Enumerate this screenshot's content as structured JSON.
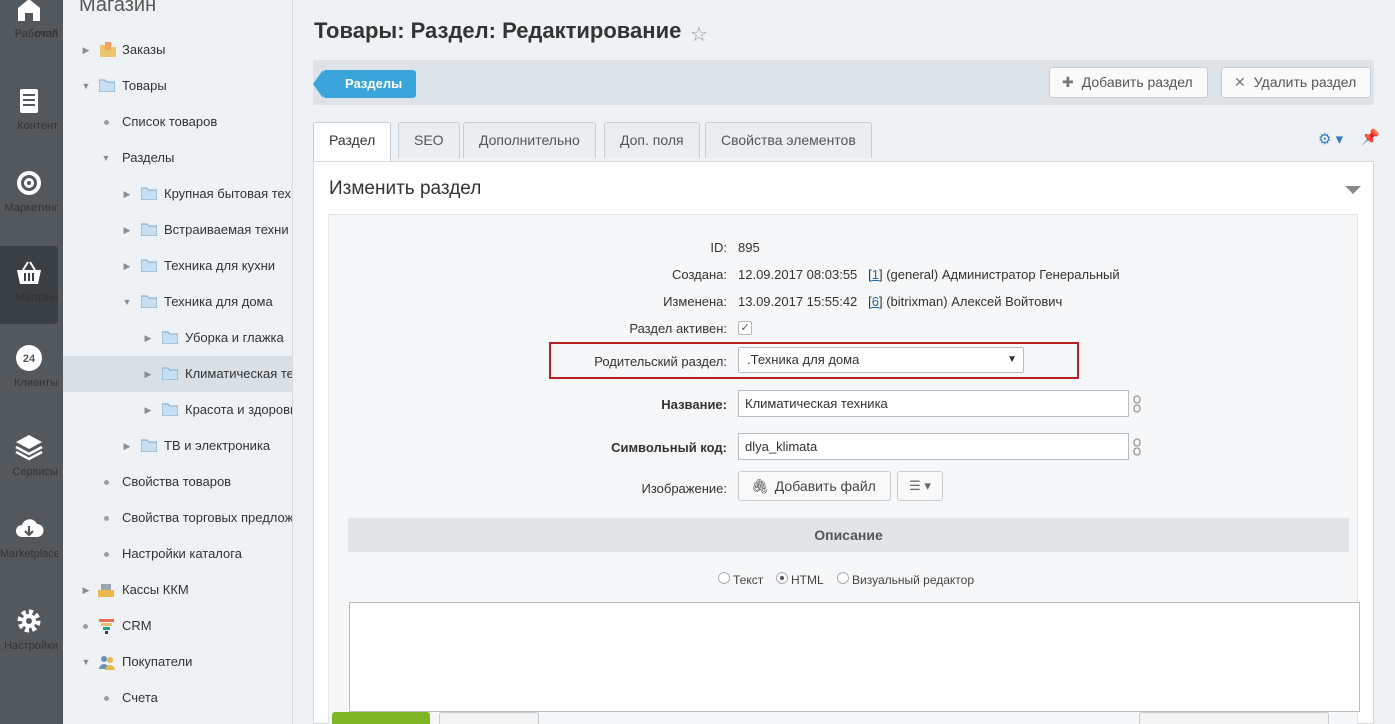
{
  "rail": {
    "items": [
      {
        "label_line1": "Рабочий",
        "label_line2": "стол",
        "icon": "home-icon"
      },
      {
        "label_line1": "Контент",
        "label_line2": "",
        "icon": "document-icon"
      },
      {
        "label_line1": "Маркетинг",
        "label_line2": "",
        "icon": "target-icon"
      },
      {
        "label_line1": "Магазин",
        "label_line2": "",
        "icon": "basket-icon"
      },
      {
        "label_line1": "Клиенты",
        "label_line2": "",
        "icon": "clients-24-icon",
        "badge": "24"
      },
      {
        "label_line1": "Сервисы",
        "label_line2": "",
        "icon": "layers-icon"
      },
      {
        "label_line1": "Marketplace",
        "label_line2": "",
        "icon": "cloud-download-icon"
      },
      {
        "label_line1": "Настройки",
        "label_line2": "",
        "icon": "gear-icon"
      }
    ]
  },
  "tree": {
    "title": "Магазин",
    "items": [
      {
        "label": "Заказы"
      },
      {
        "label": "Товары"
      },
      {
        "label": "Список товаров"
      },
      {
        "label": "Разделы"
      },
      {
        "label": "Крупная бытовая тех"
      },
      {
        "label": "Встраиваемая техни"
      },
      {
        "label": "Техника для кухни"
      },
      {
        "label": "Техника для дома"
      },
      {
        "label": "Уборка и глажка"
      },
      {
        "label": "Климатическая те"
      },
      {
        "label": "Красота и здоровь"
      },
      {
        "label": "ТВ и электроника"
      },
      {
        "label": "Свойства товаров"
      },
      {
        "label": "Свойства торговых предлож"
      },
      {
        "label": "Настройки каталога"
      },
      {
        "label": "Кассы ККМ"
      },
      {
        "label": "CRM"
      },
      {
        "label": "Покупатели"
      },
      {
        "label": "Счета"
      }
    ]
  },
  "header": {
    "title": "Товары: Раздел: Редактирование"
  },
  "toolbar": {
    "sections_label": "Разделы",
    "add_label": "Добавить раздел",
    "delete_label": "Удалить раздел"
  },
  "tabs": [
    {
      "label": "Раздел"
    },
    {
      "label": "SEO"
    },
    {
      "label": "Дополнительно"
    },
    {
      "label": "Доп. поля"
    },
    {
      "label": "Свойства элементов"
    }
  ],
  "form": {
    "heading": "Изменить раздел",
    "id_label": "ID:",
    "id_value": "895",
    "created_label": "Создана:",
    "created_date": "12.09.2017 08:03:55",
    "created_user_id": "1",
    "created_user": "(general) Администратор Генеральный",
    "modified_label": "Изменена:",
    "modified_date": "13.09.2017 15:55:42",
    "modified_user_id": "6",
    "modified_user": "(bitrixman) Алексей Войтович",
    "active_label": "Раздел активен:",
    "active": true,
    "parent_label": "Родительский раздел:",
    "parent_value": ".Техника для дома",
    "name_label": "Название:",
    "name_value": "Климатическая техника",
    "code_label": "Символьный код:",
    "code_value": "dlya_klimata",
    "image_label": "Изображение:",
    "add_file_label": "Добавить файл",
    "description_header": "Описание",
    "editor_modes": [
      {
        "label": "Текст",
        "selected": false
      },
      {
        "label": "HTML",
        "selected": true
      },
      {
        "label": "Визуальный редактор",
        "selected": false
      }
    ]
  }
}
